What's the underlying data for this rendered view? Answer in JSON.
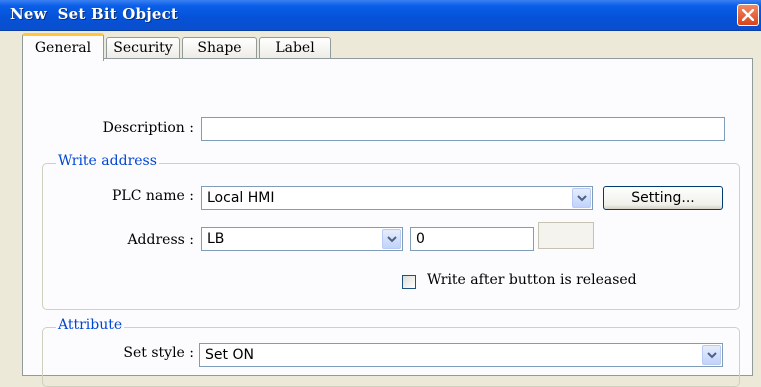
{
  "window": {
    "title": "New  Set Bit Object"
  },
  "tabs": [
    {
      "label": "General",
      "active": true
    },
    {
      "label": "Security",
      "active": false
    },
    {
      "label": "Shape",
      "active": false
    },
    {
      "label": "Label",
      "active": false
    }
  ],
  "general": {
    "description_label": "Description :",
    "description_value": ""
  },
  "write_address": {
    "title": "Write address",
    "plc_name_label": "PLC name :",
    "plc_name_value": "Local HMI",
    "setting_button": "Setting...",
    "address_label": "Address :",
    "address_device": "LB",
    "address_value": "0",
    "write_after_release_label": "Write after button is released",
    "write_after_release_checked": false
  },
  "attribute": {
    "title": "Attribute",
    "set_style_label": "Set style :",
    "set_style_value": "Set ON"
  },
  "icons": [
    "close-icon",
    "chevron-down-icon"
  ],
  "colors": {
    "titlebar": "#0a5ee8",
    "group_title": "#0046d5",
    "tab_highlight": "#ffc83c",
    "close_button": "#d8431b"
  }
}
